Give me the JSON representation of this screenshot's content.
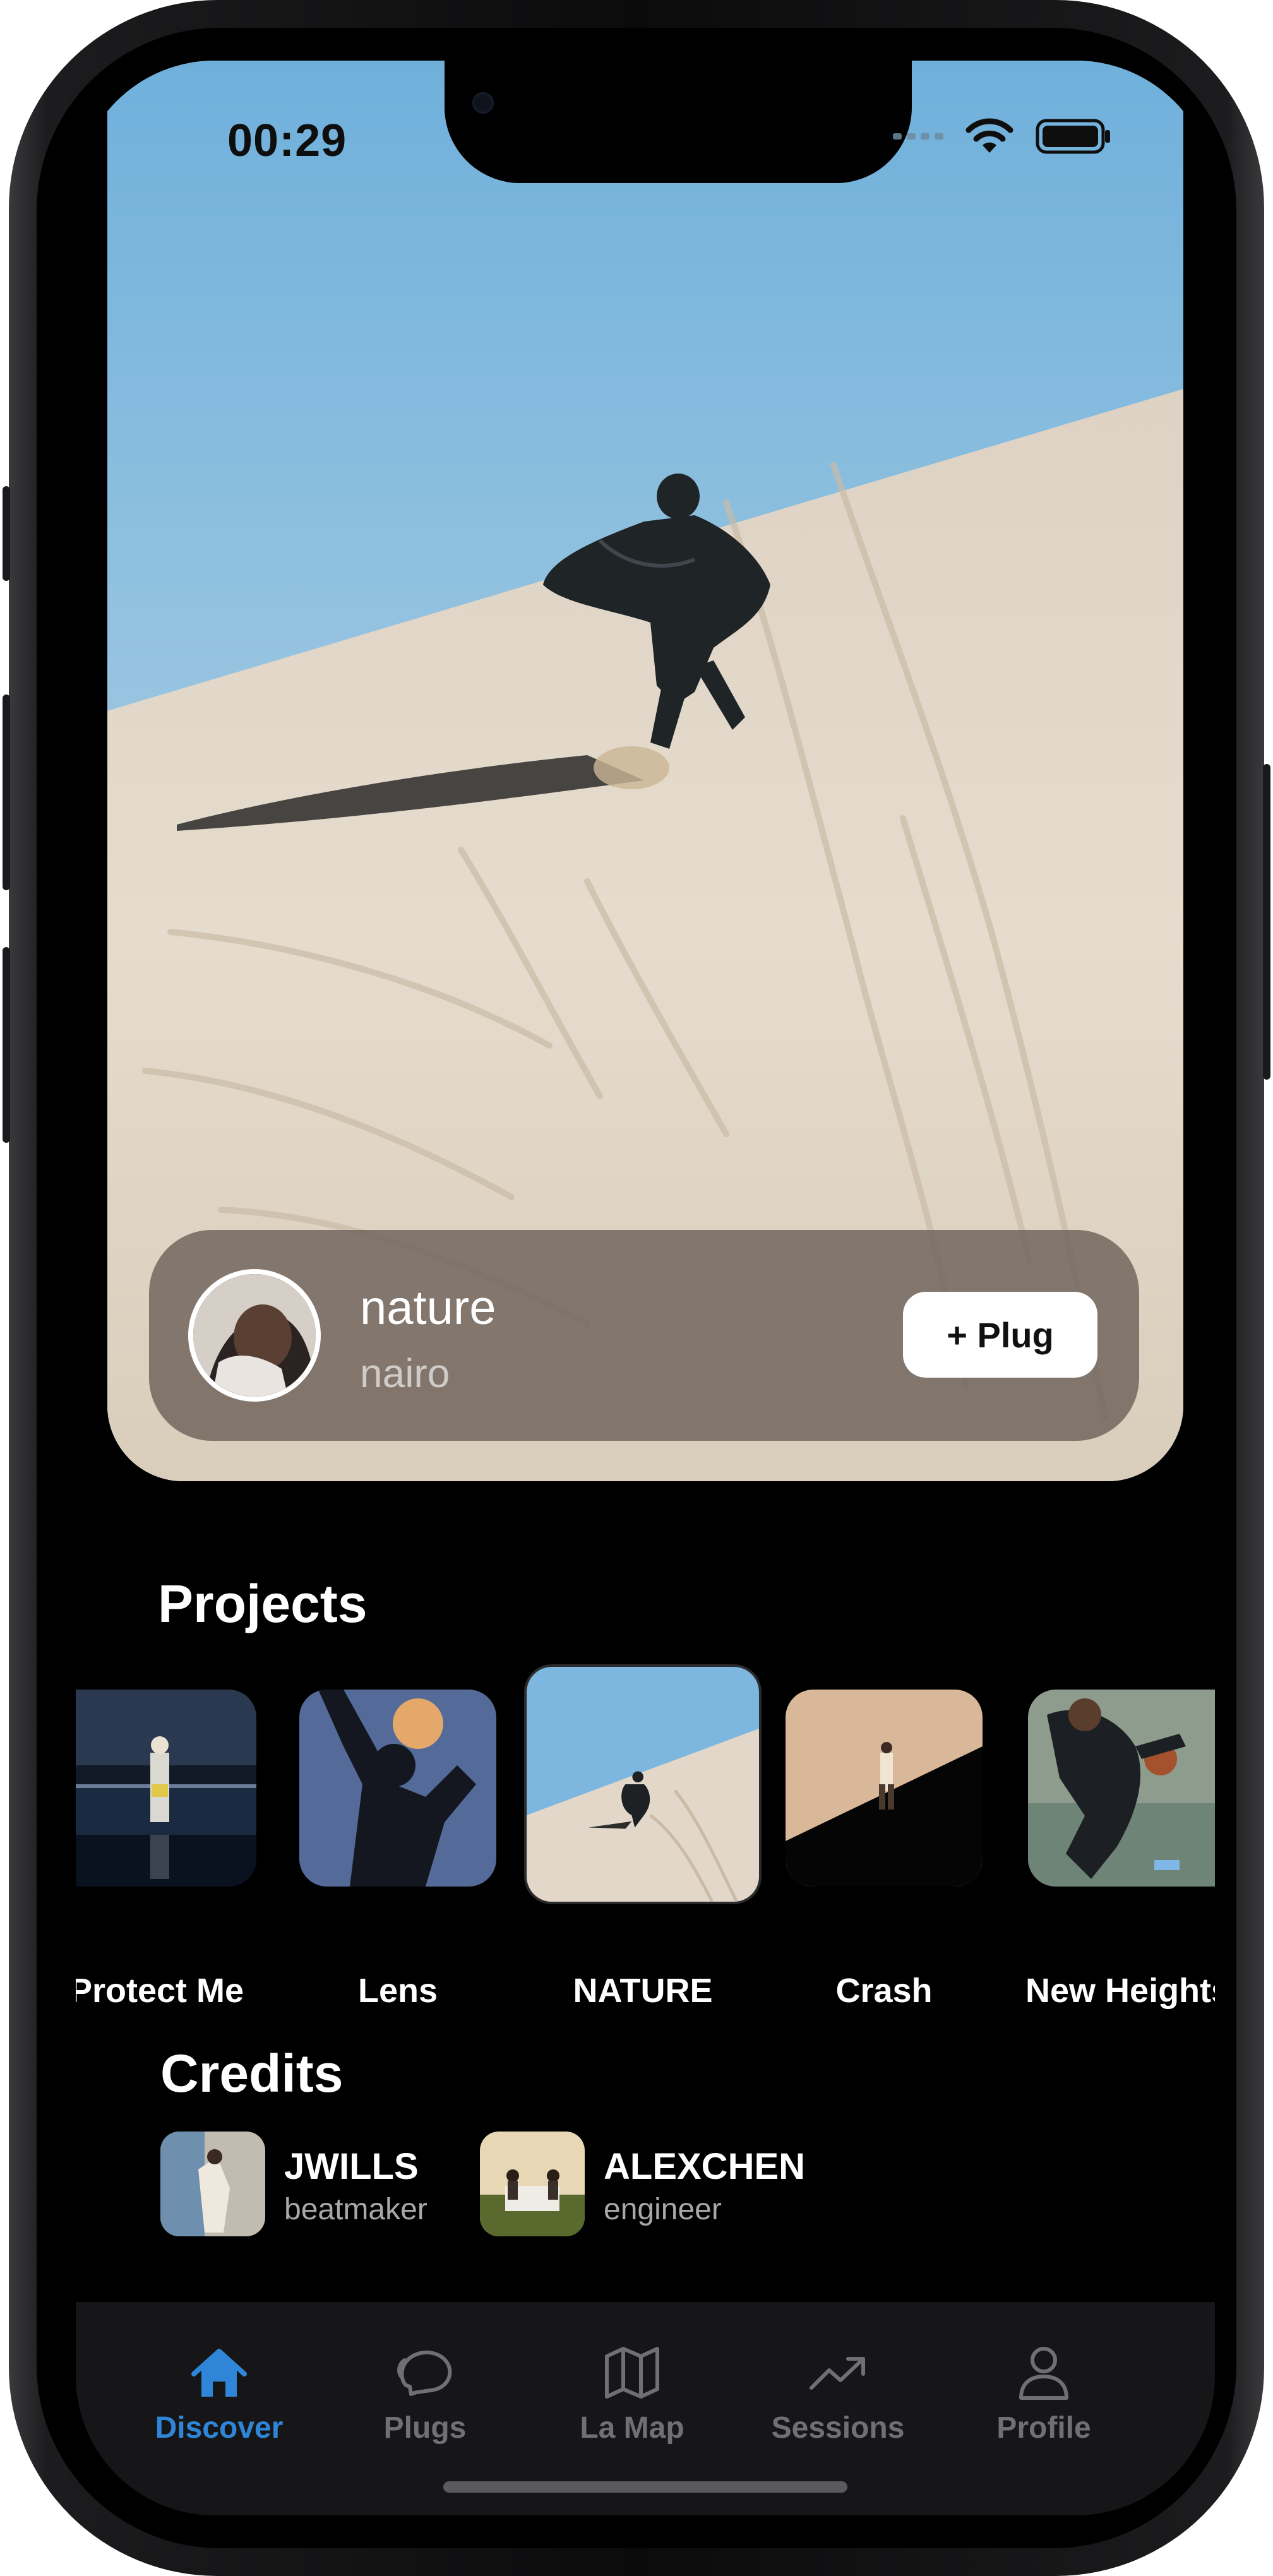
{
  "status_bar": {
    "time": "00:29",
    "icons": [
      "signal-icon",
      "wifi-icon",
      "battery-icon"
    ]
  },
  "hero": {
    "title": "nature",
    "artist": "nairo",
    "plug_button": "+ Plug"
  },
  "projects": {
    "heading": "Projects",
    "items": [
      {
        "label": "Protect Me"
      },
      {
        "label": "Lens"
      },
      {
        "label": "NATURE",
        "selected": true
      },
      {
        "label": "Crash"
      },
      {
        "label": "New Heights"
      }
    ]
  },
  "credits": {
    "heading": "Credits",
    "items": [
      {
        "name": "JWILLS",
        "role": "beatmaker"
      },
      {
        "name": "ALEXCHEN",
        "role": "engineer"
      }
    ]
  },
  "tabbar": {
    "items": [
      {
        "label": "Discover",
        "icon": "house-icon",
        "active": true
      },
      {
        "label": "Plugs",
        "icon": "chat-bubbles-icon"
      },
      {
        "label": "La Map",
        "icon": "map-icon"
      },
      {
        "label": "Sessions",
        "icon": "trending-up-icon"
      },
      {
        "label": "Profile",
        "icon": "person-icon"
      }
    ]
  },
  "colors": {
    "accent": "#2f86d8",
    "background": "#000000",
    "tab_inactive": "#707074"
  }
}
